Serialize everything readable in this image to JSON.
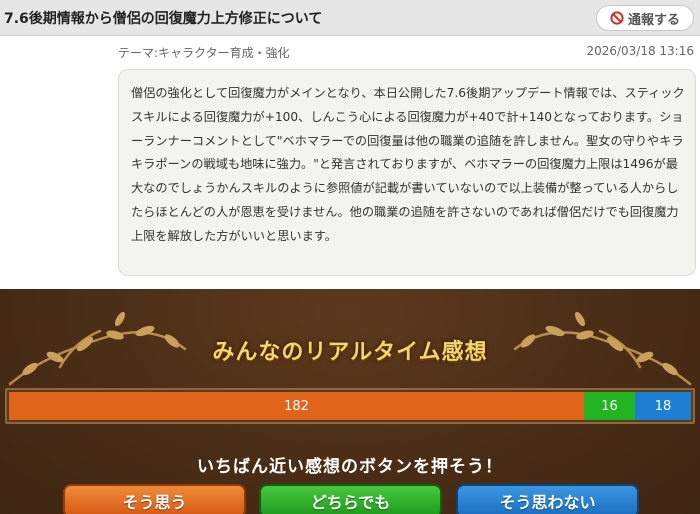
{
  "header": {
    "title": "7.6後期情報から僧侶の回復魔力上方修正について",
    "report_label": "通報する"
  },
  "post": {
    "theme": "テーマ:キャラクター育成・強化",
    "date": "2026/03/18 13:16",
    "body": "僧侶の強化として回復魔力がメインとなり、本日公開した7.6後期アップデート情報では、スティックスキルによる回復魔力が+100、しんこう心による回復魔力が+40で計+140となっております。ショーランナーコメントとして\"ベホマラーでの回復量は他の職業の追随を許しません。聖女の守りやキラキラポーンの戦域も地味に強力。\"と発言されておりますが、ベホマラーの回復魔力上限は1496が最大なのでしょうかんスキルのように参照値が記載が書いていないので以上装備が整っている人からしたらほとんどの人が恩恵を受けません。他の職業の追随を許さないのであれば僧侶だけでも回復魔力上限を解放した方がいいと思います。"
  },
  "reactions": {
    "title": "みんなのリアルタイム感想",
    "prompt": "いちばん近い感想のボタンを押そう！",
    "agree_count": 182,
    "neutral_count": 16,
    "disagree_count": 18,
    "agree_text": "182",
    "neutral_text": "16",
    "disagree_text": "18",
    "buttons": {
      "agree": "そう思う",
      "neutral": "どちらでも",
      "disagree": "そう思わない"
    },
    "colors": {
      "agree": "#e0651b",
      "neutral": "#23b421",
      "disagree": "#1d7fd1",
      "title": "#f4d76a",
      "panel": "#4a2d16"
    }
  },
  "icons": {
    "report": "prohibited-icon"
  }
}
